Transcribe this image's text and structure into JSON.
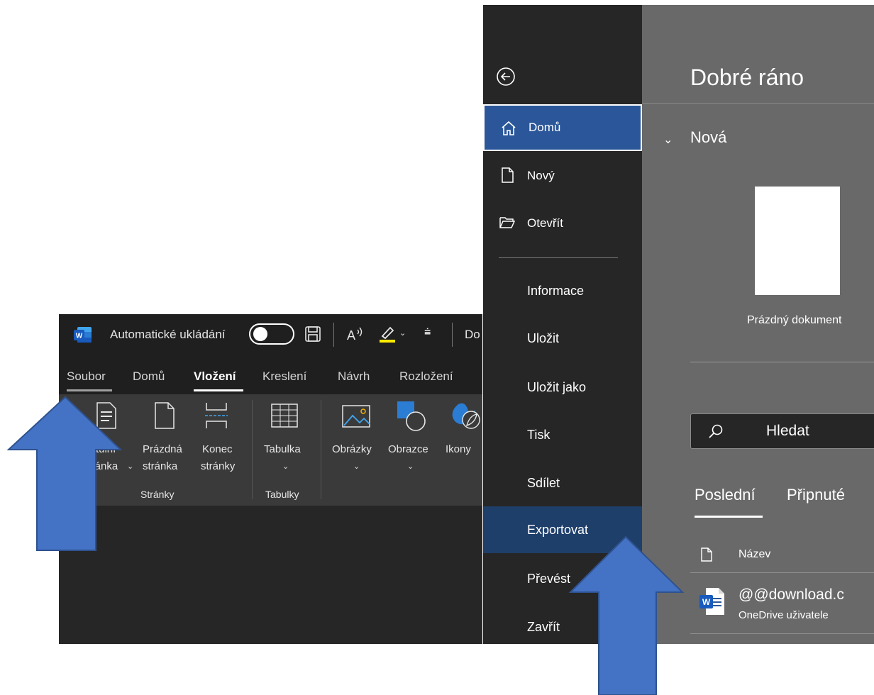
{
  "word": {
    "autosave_label": "Automatické ukládání",
    "doc_title_partial": "Do",
    "tabs": [
      "Soubor",
      "Domů",
      "Vložení",
      "Kreslení",
      "Návrh",
      "Rozložení"
    ],
    "active_tab": "Vložení",
    "ribbon": {
      "cover_page": {
        "line1": "Titulní",
        "line2": "stránka"
      },
      "blank_page": {
        "line1": "Prázdná",
        "line2": "stránka"
      },
      "page_break": {
        "line1": "Konec",
        "line2": "stránky"
      },
      "pages_group": "Stránky",
      "table": "Tabulka",
      "tables_group": "Tabulky",
      "pictures": "Obrázky",
      "shapes": "Obrazce",
      "icons": "Ikony"
    }
  },
  "backstage": {
    "greeting": "Dobré ráno",
    "nav": [
      {
        "label": "Domů",
        "icon": "home-icon",
        "selected": true
      },
      {
        "label": "Nový",
        "icon": "new-document-icon"
      },
      {
        "label": "Otevřít",
        "icon": "open-folder-icon"
      },
      {
        "label": "Informace"
      },
      {
        "label": "Uložit"
      },
      {
        "label": "Uložit jako"
      },
      {
        "label": "Tisk"
      },
      {
        "label": "Sdílet"
      },
      {
        "label": "Exportovat",
        "highlighted": true
      },
      {
        "label": "Převést"
      },
      {
        "label": "Zavřít"
      }
    ],
    "new_section": "Nová",
    "blank_doc_label": "Prázdný dokument",
    "search_placeholder": "Hledat",
    "file_tabs": [
      "Poslední",
      "Připnuté"
    ],
    "active_file_tab": "Poslední",
    "column_name": "Název",
    "recent_file": {
      "name": "@@download.c",
      "location": "OneDrive uživatele"
    }
  },
  "colors": {
    "accent_blue": "#2b579a",
    "export_highlight": "#1f3f6b",
    "arrow_fill": "#4472c4",
    "arrow_stroke": "#2f528f"
  }
}
